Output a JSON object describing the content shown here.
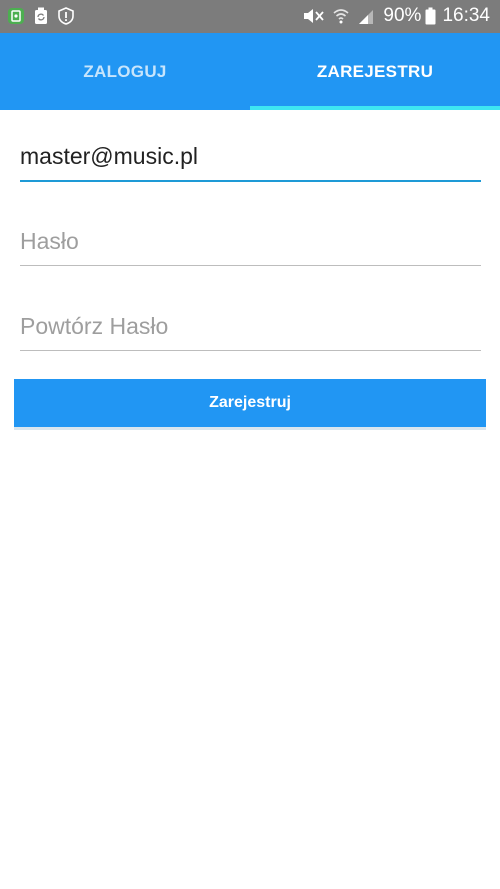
{
  "status_bar": {
    "battery_percent": "90%",
    "time": "16:34",
    "icons": [
      "app-notification-icon",
      "recycle-icon",
      "alert-shield-icon",
      "mute-icon",
      "wifi-icon",
      "signal-icon",
      "battery-icon"
    ]
  },
  "tabs": [
    {
      "label": "ZALOGUJ",
      "active": false
    },
    {
      "label": "ZAREJESTRU",
      "active": true
    }
  ],
  "form": {
    "email": {
      "value": "master@music.pl",
      "placeholder": ""
    },
    "password": {
      "value": "",
      "placeholder": "Hasło"
    },
    "repeat_password": {
      "value": "",
      "placeholder": "Powtórz Hasło"
    },
    "submit_label": "Zarejestruj"
  },
  "colors": {
    "primary": "#2196f3",
    "tab_indicator": "#3ee6f2",
    "focus_underline": "#1e9ad6",
    "status_bar": "#7c7c7c"
  }
}
